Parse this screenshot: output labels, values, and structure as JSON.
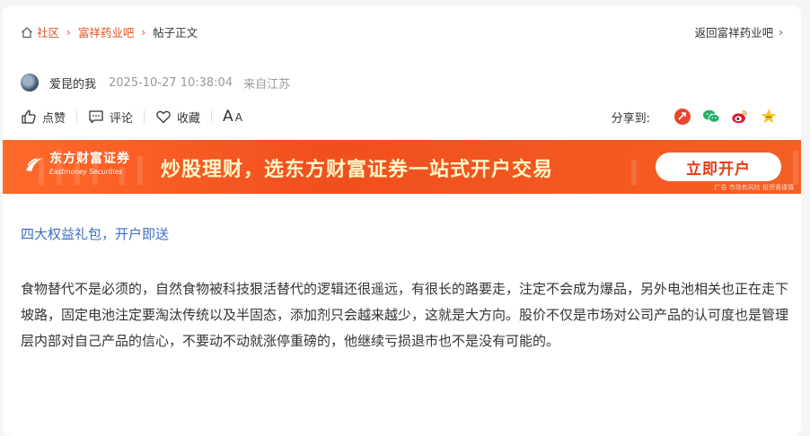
{
  "breadcrumb": {
    "items": [
      "社区",
      "富祥药业吧"
    ],
    "current": "帖子正文",
    "back_label": "返回富祥药业吧"
  },
  "post": {
    "author": "爱昆的我",
    "time": "2025-10-27 10:38:04",
    "location": "来自江苏",
    "promo_link": "四大权益礼包，开户即送",
    "body": "食物替代不是必须的，自然食物被科技狠活替代的逻辑还很遥远，有很长的路要走，注定不会成为爆品，另外电池相关也正在走下坡路，固定电池注定要淘汰传统以及半固态，添加剂只会越来越少，这就是大方向。股价不仅是市场对公司产品的认可度也是管理层内部对自己产品的信心，不要动不动就涨停重磅的，他继续亏损退市也不是没有可能的。"
  },
  "actions": {
    "like": "点赞",
    "comment": "评论",
    "favorite": "收藏",
    "font_big": "A",
    "font_small": "A"
  },
  "share": {
    "label": "分享到:",
    "icons": [
      "share-app-icon",
      "wechat-icon",
      "weibo-icon",
      "favorite-star-icon"
    ]
  },
  "banner": {
    "brand_cn": "东方财富证券",
    "brand_en": "Eastmoney Securities",
    "slogan": "炒股理财，选东方财富证券一站式开户交易",
    "cta": "立即开户",
    "disclaimer": "广告 市场有风险 投资需谨慎"
  },
  "colors": {
    "accent": "#e1501e",
    "link": "#3a6fc2",
    "banner": "#f14f1e"
  }
}
